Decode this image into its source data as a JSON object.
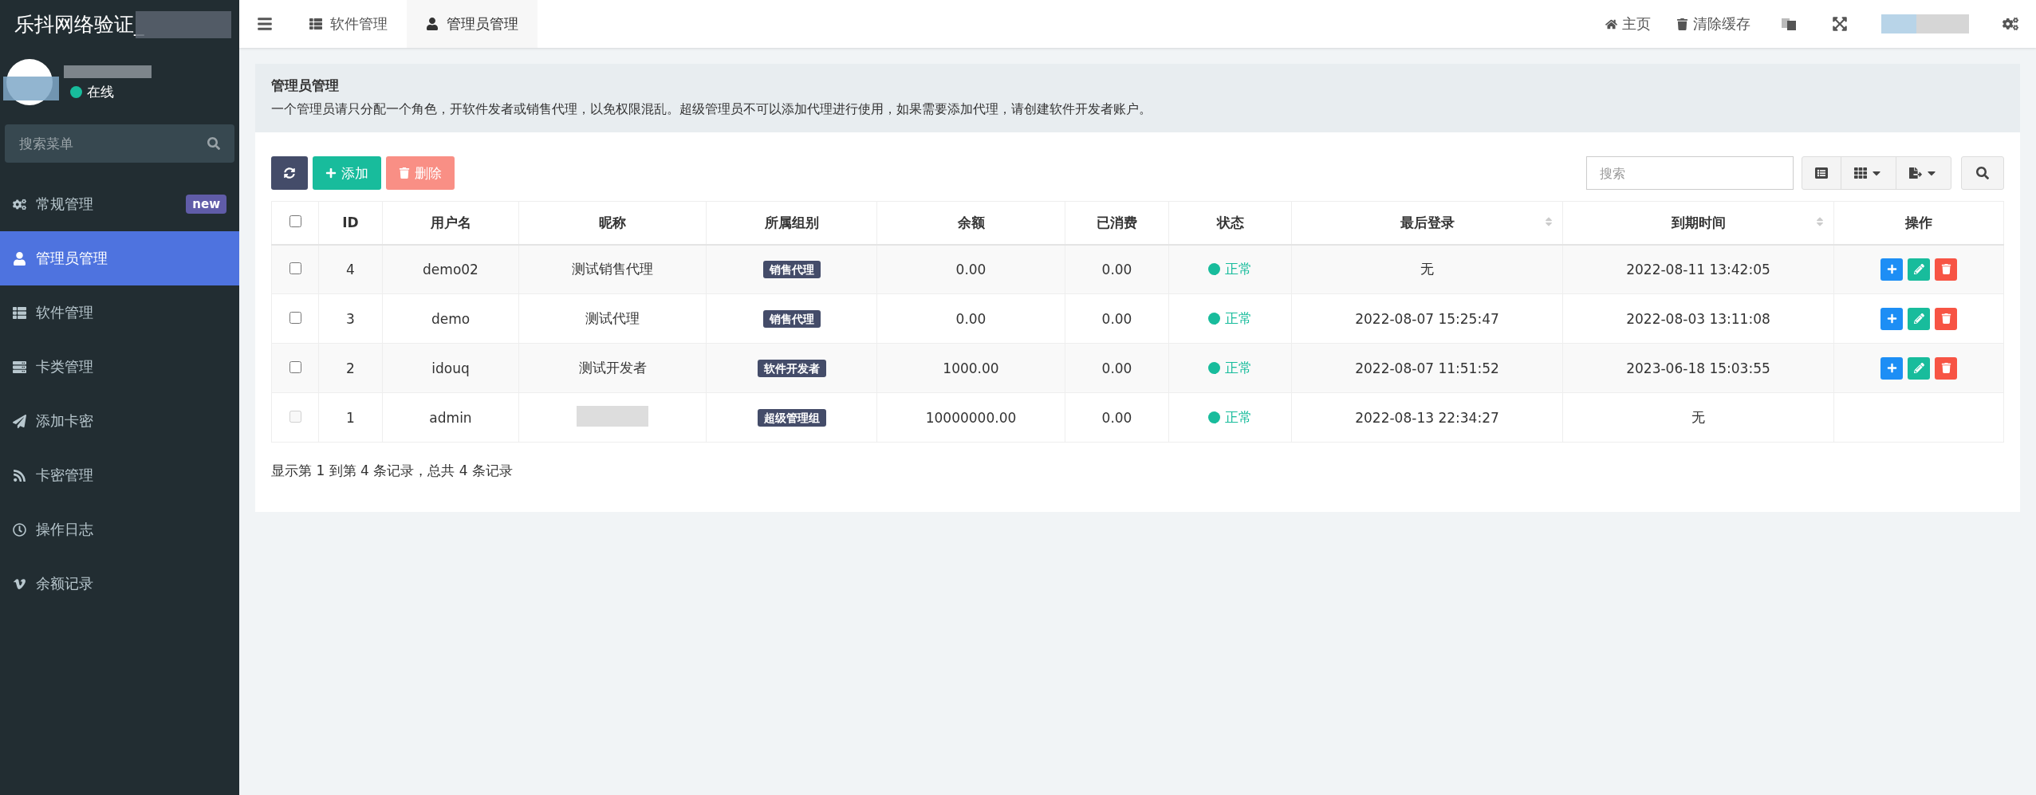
{
  "sidebar": {
    "title": "乐抖网络验证_",
    "user": {
      "status": "在线",
      "online": true
    },
    "search": {
      "placeholder": "搜索菜单"
    },
    "items": [
      {
        "label": "常规管理",
        "badge": "new",
        "selected": false
      },
      {
        "label": "管理员管理",
        "selected": true
      },
      {
        "label": "软件管理",
        "selected": false
      },
      {
        "label": "卡类管理",
        "selected": false
      },
      {
        "label": "添加卡密",
        "selected": false
      },
      {
        "label": "卡密管理",
        "selected": false
      },
      {
        "label": "操作日志",
        "selected": false
      },
      {
        "label": "余额记录",
        "selected": false
      }
    ]
  },
  "topbar": {
    "tabs": [
      {
        "label": "软件管理",
        "selected": false
      },
      {
        "label": "管理员管理",
        "selected": true
      }
    ],
    "links": [
      "主页",
      "清除缓存"
    ]
  },
  "panel": {
    "title": "管理员管理",
    "description": "一个管理员请只分配一个角色，开软件发者或销售代理，以免权限混乱。超级管理员不可以添加代理进行使用，如果需要添加代理，请创建软件开发者账户。"
  },
  "toolbar": {
    "buttons": [
      {
        "kind": "refresh",
        "disabled": false
      },
      {
        "kind": "add",
        "label": "添加",
        "disabled": false
      },
      {
        "kind": "delete",
        "label": "删除",
        "disabled": true
      }
    ],
    "search": {
      "placeholder": "搜索"
    }
  },
  "table": {
    "header_checked": false,
    "columns": [
      {
        "label": "ID",
        "sortable": false
      },
      {
        "label": "用户名",
        "sortable": false
      },
      {
        "label": "昵称",
        "sortable": false
      },
      {
        "label": "所属组别",
        "sortable": false
      },
      {
        "label": "余额",
        "sortable": false
      },
      {
        "label": "已消费",
        "sortable": false
      },
      {
        "label": "状态",
        "sortable": false
      },
      {
        "label": "最后登录",
        "sortable": true
      },
      {
        "label": "到期时间",
        "sortable": true
      },
      {
        "label": "操作",
        "sortable": false
      }
    ],
    "rows": [
      {
        "checked": false,
        "disabled": false,
        "id": "4",
        "username": "demo02",
        "nickname": "测试销售代理",
        "group": "销售代理",
        "balance": "0.00",
        "spent": "0.00",
        "status": "正常",
        "last_login": "无",
        "expires": "2022-08-11 13:42:05",
        "actions": true
      },
      {
        "checked": false,
        "disabled": false,
        "id": "3",
        "username": "demo",
        "nickname": "测试代理",
        "group": "销售代理",
        "balance": "0.00",
        "spent": "0.00",
        "status": "正常",
        "last_login": "2022-08-07 15:25:47",
        "expires": "2022-08-03 13:11:08",
        "actions": true
      },
      {
        "checked": false,
        "disabled": false,
        "id": "2",
        "username": "idouq",
        "nickname": "测试开发者",
        "group": "软件开发者",
        "balance": "1000.00",
        "spent": "0.00",
        "status": "正常",
        "last_login": "2022-08-07 11:51:52",
        "expires": "2023-06-18 15:03:55",
        "actions": true
      },
      {
        "checked": false,
        "disabled": true,
        "id": "1",
        "username": "admin",
        "group": "超级管理组",
        "balance": "10000000.00",
        "spent": "0.00",
        "status": "正常",
        "last_login": "2022-08-13 22:34:27",
        "expires": "无",
        "actions": false
      }
    ]
  },
  "footer": "显示第 1 到第 4 条记录，总共 4 条记录"
}
